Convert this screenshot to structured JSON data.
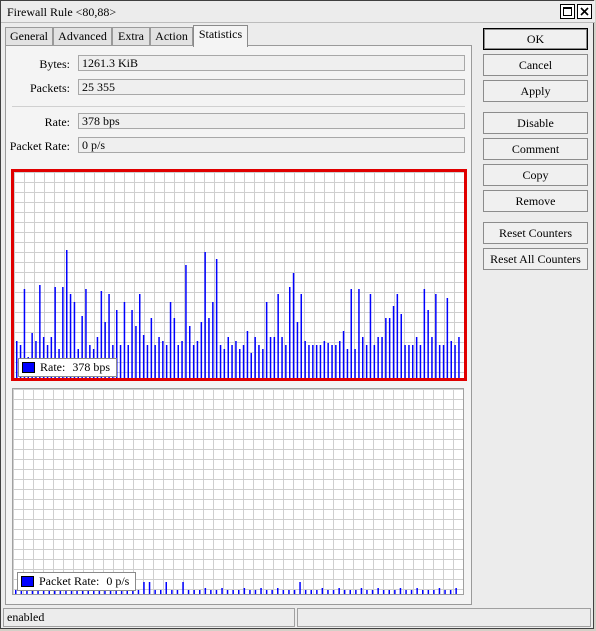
{
  "window": {
    "title": "Firewall Rule <80,88>"
  },
  "tabs": [
    {
      "label": "General"
    },
    {
      "label": "Advanced"
    },
    {
      "label": "Extra"
    },
    {
      "label": "Action"
    },
    {
      "label": "Statistics"
    }
  ],
  "active_tab": "Statistics",
  "fields": {
    "bytes": {
      "label": "Bytes:",
      "value": "1261.3 KiB"
    },
    "packets": {
      "label": "Packets:",
      "value": "25 355"
    },
    "rate": {
      "label": "Rate:",
      "value": "378 bps"
    },
    "packet_rate": {
      "label": "Packet Rate:",
      "value": "0 p/s"
    }
  },
  "buttons": {
    "ok": "OK",
    "cancel": "Cancel",
    "apply": "Apply",
    "disable": "Disable",
    "comment": "Comment",
    "copy": "Copy",
    "remove": "Remove",
    "reset_counters": "Reset Counters",
    "reset_all_counters": "Reset All Counters"
  },
  "graphs": {
    "rate": {
      "legend_label": "Rate:",
      "legend_value": "378 bps",
      "series_color": "#0000ff",
      "highlight_color": "#e00000",
      "bars": [
        0.18,
        0.16,
        0.43,
        0.1,
        0.22,
        0.18,
        0.45,
        0.2,
        0.16,
        0.2,
        0.44,
        0.14,
        0.44,
        0.62,
        0.41,
        0.37,
        0.14,
        0.3,
        0.43,
        0.16,
        0.14,
        0.2,
        0.42,
        0.27,
        0.41,
        0.16,
        0.33,
        0.16,
        0.37,
        0.16,
        0.33,
        0.25,
        0.41,
        0.21,
        0.16,
        0.29,
        0.16,
        0.2,
        0.18,
        0.16,
        0.37,
        0.29,
        0.16,
        0.18,
        0.55,
        0.25,
        0.16,
        0.18,
        0.27,
        0.61,
        0.29,
        0.37,
        0.58,
        0.16,
        0.14,
        0.2,
        0.16,
        0.18,
        0.14,
        0.16,
        0.23,
        0.12,
        0.2,
        0.16,
        0.14,
        0.37,
        0.2,
        0.2,
        0.41,
        0.2,
        0.16,
        0.44,
        0.51,
        0.27,
        0.41,
        0.18,
        0.16,
        0.16,
        0.16,
        0.16,
        0.18,
        0.17,
        0.16,
        0.16,
        0.18,
        0.23,
        0.14,
        0.43,
        0.14,
        0.43,
        0.2,
        0.16,
        0.41,
        0.16,
        0.2,
        0.2,
        0.29,
        0.29,
        0.35,
        0.41,
        0.31,
        0.16,
        0.16,
        0.16,
        0.2,
        0.16,
        0.43,
        0.33,
        0.2,
        0.41,
        0.16,
        0.16,
        0.39,
        0.18,
        0.16,
        0.2
      ],
      "bars_min": 0.1
    },
    "packet_rate": {
      "legend_label": "Packet Rate:",
      "legend_value": "0 p/s",
      "series_color": "#0000ff",
      "bars": [
        0.02,
        0.02,
        0.02,
        0.03,
        0.02,
        0.02,
        0.02,
        0.03,
        0.02,
        0.02,
        0.02,
        0.03,
        0.02,
        0.02,
        0.02,
        0.03,
        0.02,
        0.02,
        0.02,
        0.02,
        0.03,
        0.02,
        0.02,
        0.06,
        0.06,
        0.02,
        0.02,
        0.06,
        0.02,
        0.02,
        0.06,
        0.02,
        0.02,
        0.02,
        0.03,
        0.02,
        0.02,
        0.03,
        0.02,
        0.02,
        0.02,
        0.03,
        0.02,
        0.02,
        0.03,
        0.02,
        0.02,
        0.03,
        0.02,
        0.02,
        0.02,
        0.06,
        0.02,
        0.02,
        0.02,
        0.03,
        0.02,
        0.02,
        0.03,
        0.02,
        0.02,
        0.02,
        0.03,
        0.02,
        0.02,
        0.03,
        0.02,
        0.02,
        0.02,
        0.03,
        0.02,
        0.02,
        0.03,
        0.02,
        0.02,
        0.02,
        0.03,
        0.02,
        0.02,
        0.03
      ]
    }
  },
  "status": {
    "text": "enabled"
  }
}
